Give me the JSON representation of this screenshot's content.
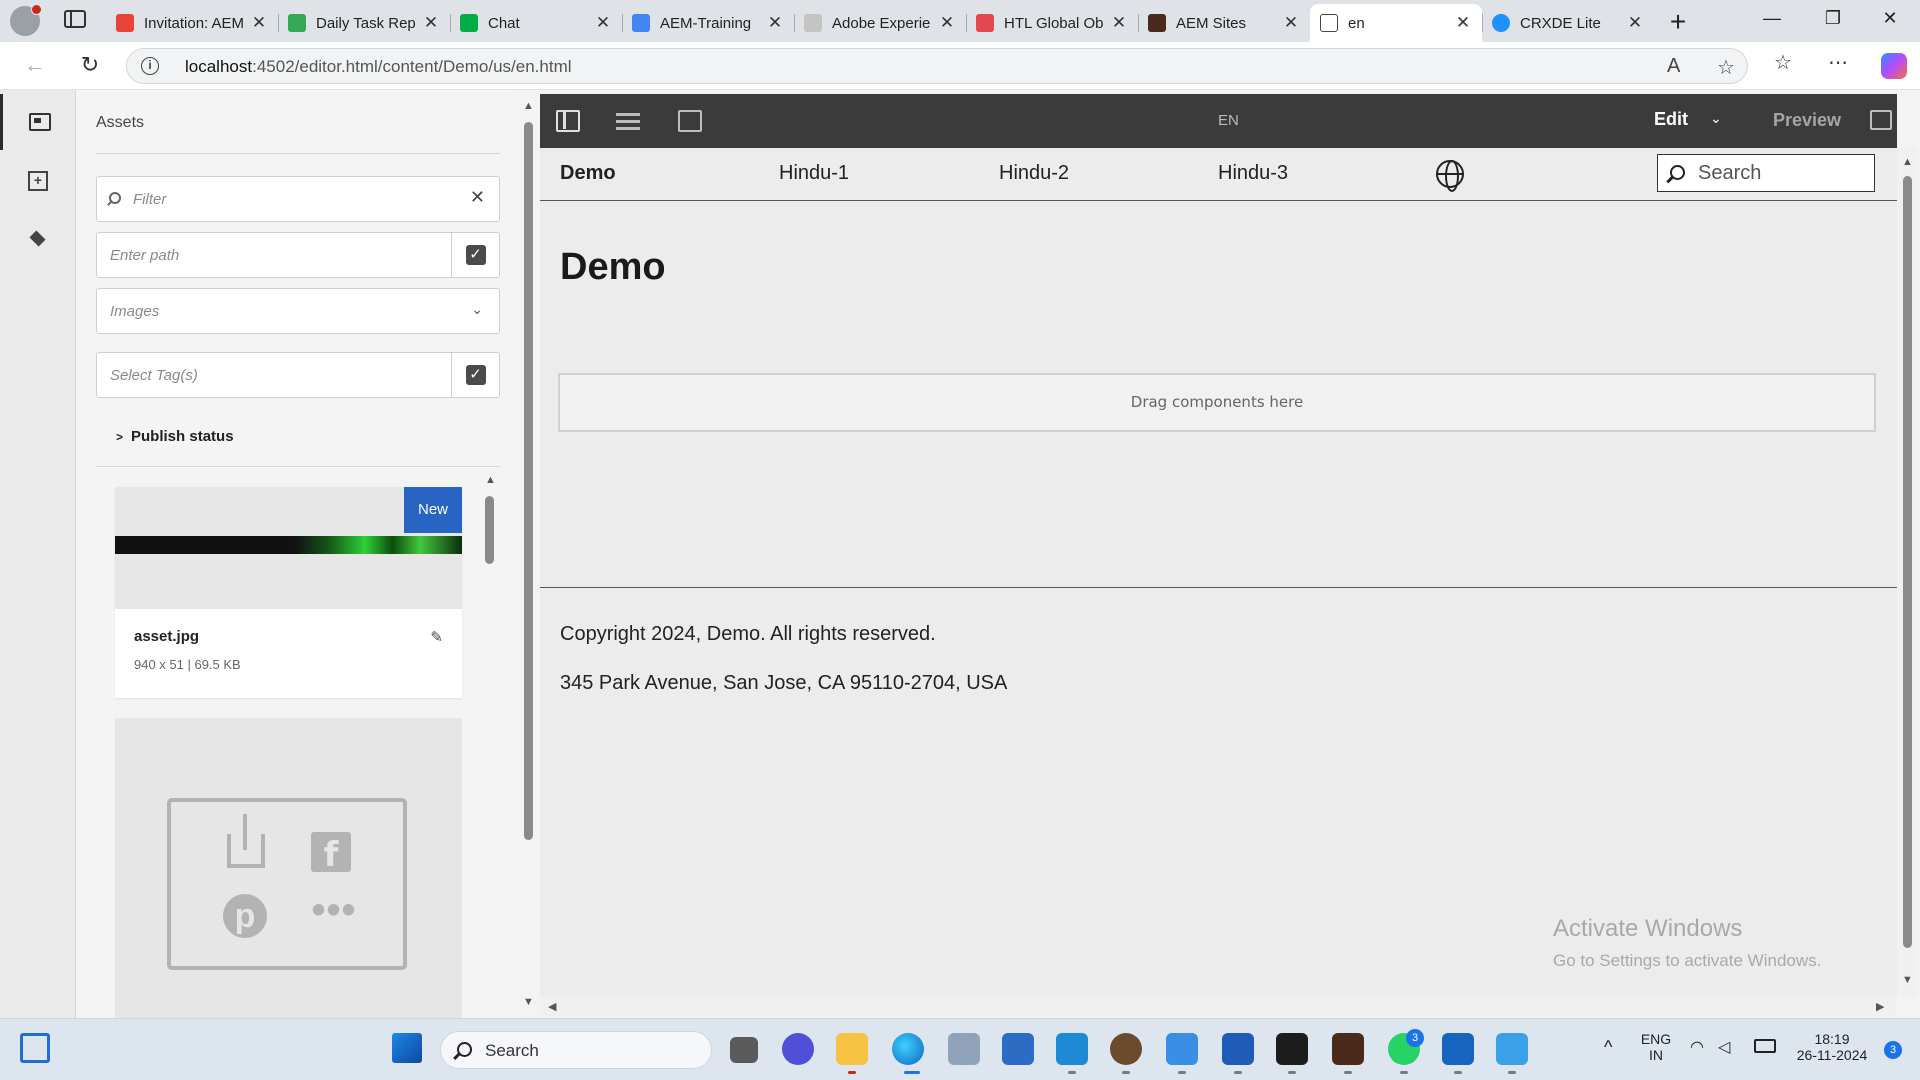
{
  "browser": {
    "tabs": [
      {
        "title": "Invitation: AEM",
        "favicon_color": "#ea4335",
        "active": false
      },
      {
        "title": "Daily Task Rep",
        "favicon_color": "#34a853",
        "active": false
      },
      {
        "title": "Chat",
        "favicon_color": "#00ac47",
        "active": false
      },
      {
        "title": "AEM-Training",
        "favicon_color": "#4285f4",
        "active": false
      },
      {
        "title": "Adobe Experie",
        "favicon_color": "#c4c4c4",
        "active": false
      },
      {
        "title": "HTL Global Ob",
        "favicon_color": "#e34850",
        "active": false
      },
      {
        "title": "AEM Sites",
        "favicon_color": "#4a2a1a",
        "active": false
      },
      {
        "title": "en",
        "favicon_color": "#ffffff",
        "active": true
      },
      {
        "title": "CRXDE Lite",
        "favicon_color": "#1e90ff",
        "active": false
      }
    ],
    "url_host": "localhost",
    "url_rest": ":4502/editor.html/content/Demo/us/en.html",
    "copilot_badge": "1"
  },
  "rail": {
    "items": [
      {
        "name": "assets",
        "icon": "assets-icon",
        "active": true
      },
      {
        "name": "components",
        "icon": "components-icon",
        "active": false
      },
      {
        "name": "content-tree",
        "icon": "layers-icon",
        "active": false
      }
    ]
  },
  "assets_panel": {
    "heading": "Assets",
    "filter_placeholder": "Filter",
    "path_placeholder": "Enter path",
    "type_value": "Images",
    "tags_placeholder": "Select Tag(s)",
    "publish_status_label": "Publish status",
    "cards": [
      {
        "name": "asset.jpg",
        "meta": "940 x 51 | 69.5 KB",
        "badge": "New"
      }
    ]
  },
  "editor_toolbar": {
    "language": "EN",
    "mode": "Edit",
    "preview": "Preview"
  },
  "page": {
    "nav": {
      "brand": "Demo",
      "links": [
        "Hindu-1",
        "Hindu-2",
        "Hindu-3"
      ],
      "search_placeholder": "Search"
    },
    "title": "Demo",
    "dropzone": "Drag components here",
    "footer": {
      "copyright": "Copyright 2024, Demo. All rights reserved.",
      "address": "345 Park Avenue, San Jose, CA 95110-2704, USA"
    }
  },
  "watermark": {
    "line1": "Activate Windows",
    "line2": "Go to Settings to activate Windows."
  },
  "taskbar": {
    "search_label": "Search",
    "lang_line1": "ENG",
    "lang_line2": "IN",
    "time": "18:19",
    "date": "26-11-2024",
    "whatsapp_badge": "3",
    "notification_count": "3"
  }
}
